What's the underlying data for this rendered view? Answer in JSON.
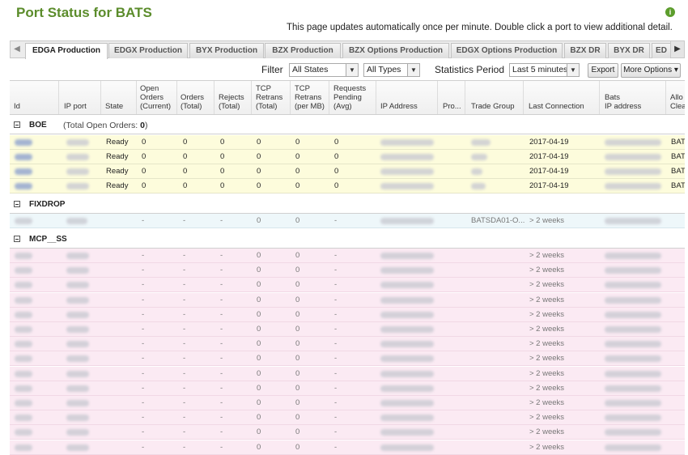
{
  "header": {
    "title": "Port Status for BATS",
    "info": "This page updates automatically once per minute. Double click a port to view additional detail.",
    "help_icon": "help-icon"
  },
  "tabs": [
    {
      "label": "EDGA Production",
      "active": true
    },
    {
      "label": "EDGX Production",
      "active": false
    },
    {
      "label": "BYX Production",
      "active": false
    },
    {
      "label": "BZX Production",
      "active": false
    },
    {
      "label": "BZX Options Production",
      "active": false
    },
    {
      "label": "EDGX Options Production",
      "active": false
    },
    {
      "label": "BZX DR",
      "active": false
    },
    {
      "label": "BYX DR",
      "active": false
    },
    {
      "label": "ED",
      "active": false
    }
  ],
  "toolbar": {
    "filter_label": "Filter",
    "state_select": "All States",
    "type_select": "All Types",
    "stats_label": "Statistics Period",
    "period_select": "Last 5 minutes",
    "export_label": "Export",
    "more_label": "More Options ▾"
  },
  "columns": [
    "Id",
    "IP port",
    "State",
    "Open\nOrders\n(Current)",
    "Orders\n(Total)",
    "Rejects\n(Total)",
    "TCP\nRetrans\n(Total)",
    "TCP\nRetrans\n(per MB)",
    "Requests\nPending\n(Avg)",
    "IP Address",
    "Pro...",
    "Trade Group",
    "Last Connection",
    "Bats\nIP address",
    "Allo\nClea"
  ],
  "groups": {
    "boe": {
      "name": "BOE",
      "sub_prefix": "(Total Open Orders: ",
      "sub_value": "0",
      "sub_suffix": ")"
    },
    "fixdrop": {
      "name": "FIXDROP"
    },
    "mcp": {
      "name": "MCP__SS"
    }
  },
  "boe_rows": [
    {
      "state": "Ready",
      "open": "0",
      "orders": "0",
      "rejects": "0",
      "tcp_total": "0",
      "tcp_mb": "0",
      "req": "0",
      "last": "2017-04-19",
      "allo": "BAT"
    },
    {
      "state": "Ready",
      "open": "0",
      "orders": "0",
      "rejects": "0",
      "tcp_total": "0",
      "tcp_mb": "0",
      "req": "0",
      "last": "2017-04-19",
      "allo": "BAT"
    },
    {
      "state": "Ready",
      "open": "0",
      "orders": "0",
      "rejects": "0",
      "tcp_total": "0",
      "tcp_mb": "0",
      "req": "0",
      "last": "2017-04-19",
      "allo": "BAT"
    },
    {
      "state": "Ready",
      "open": "0",
      "orders": "0",
      "rejects": "0",
      "tcp_total": "0",
      "tcp_mb": "0",
      "req": "0",
      "last": "2017-04-19",
      "allo": "BAT"
    }
  ],
  "fix_row": {
    "open": "-",
    "orders": "-",
    "rejects": "-",
    "tcp_total": "0",
    "tcp_mb": "0",
    "req": "-",
    "trade_group": "BATSDA01-O...",
    "last": "> 2 weeks"
  },
  "mcp_rows": [
    {
      "open": "-",
      "orders": "-",
      "rejects": "-",
      "tcp_total": "0",
      "tcp_mb": "0",
      "req": "-",
      "last": "> 2 weeks"
    },
    {
      "open": "-",
      "orders": "-",
      "rejects": "-",
      "tcp_total": "0",
      "tcp_mb": "0",
      "req": "-",
      "last": "> 2 weeks"
    },
    {
      "open": "-",
      "orders": "-",
      "rejects": "-",
      "tcp_total": "0",
      "tcp_mb": "0",
      "req": "-",
      "last": "> 2 weeks"
    },
    {
      "open": "-",
      "orders": "-",
      "rejects": "-",
      "tcp_total": "0",
      "tcp_mb": "0",
      "req": "-",
      "last": "> 2 weeks"
    },
    {
      "open": "-",
      "orders": "-",
      "rejects": "-",
      "tcp_total": "0",
      "tcp_mb": "0",
      "req": "-",
      "last": "> 2 weeks"
    },
    {
      "open": "-",
      "orders": "-",
      "rejects": "-",
      "tcp_total": "0",
      "tcp_mb": "0",
      "req": "-",
      "last": "> 2 weeks"
    },
    {
      "open": "-",
      "orders": "-",
      "rejects": "-",
      "tcp_total": "0",
      "tcp_mb": "0",
      "req": "-",
      "last": "> 2 weeks"
    },
    {
      "open": "-",
      "orders": "-",
      "rejects": "-",
      "tcp_total": "0",
      "tcp_mb": "0",
      "req": "-",
      "last": "> 2 weeks"
    },
    {
      "open": "-",
      "orders": "-",
      "rejects": "-",
      "tcp_total": "0",
      "tcp_mb": "0",
      "req": "-",
      "last": "> 2 weeks"
    },
    {
      "open": "-",
      "orders": "-",
      "rejects": "-",
      "tcp_total": "0",
      "tcp_mb": "0",
      "req": "-",
      "last": "> 2 weeks"
    },
    {
      "open": "-",
      "orders": "-",
      "rejects": "-",
      "tcp_total": "0",
      "tcp_mb": "0",
      "req": "-",
      "last": "> 2 weeks"
    },
    {
      "open": "-",
      "orders": "-",
      "rejects": "-",
      "tcp_total": "0",
      "tcp_mb": "0",
      "req": "-",
      "last": "> 2 weeks"
    },
    {
      "open": "-",
      "orders": "-",
      "rejects": "-",
      "tcp_total": "0",
      "tcp_mb": "0",
      "req": "-",
      "last": "> 2 weeks"
    },
    {
      "open": "-",
      "orders": "-",
      "rejects": "-",
      "tcp_total": "0",
      "tcp_mb": "0",
      "req": "-",
      "last": "> 2 weeks"
    }
  ]
}
